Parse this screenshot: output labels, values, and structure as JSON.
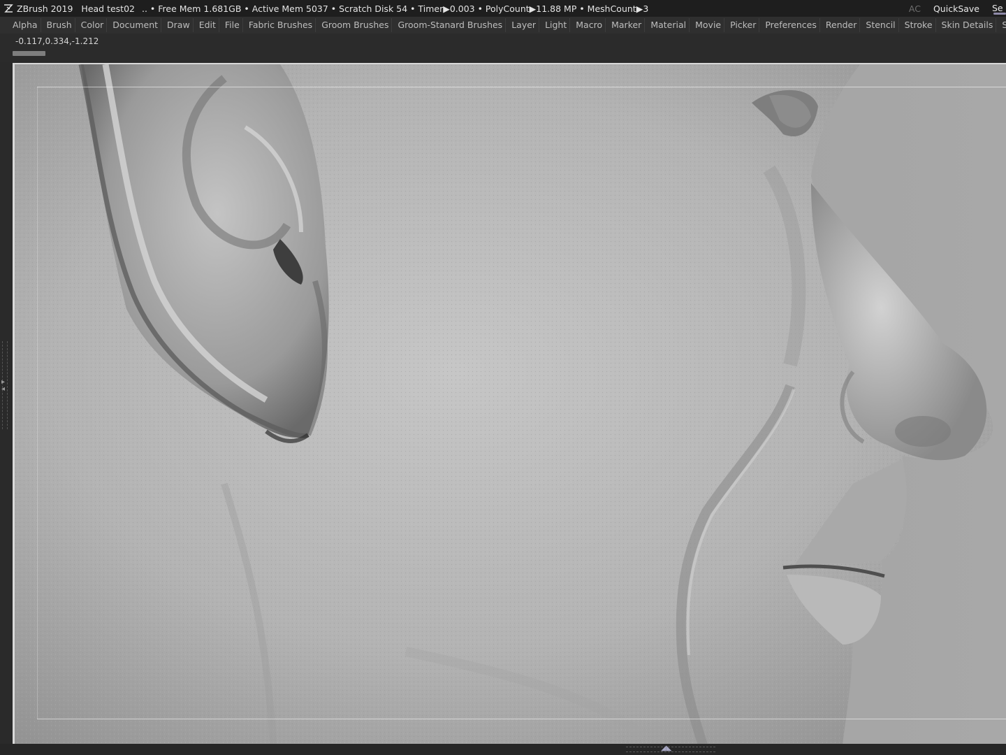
{
  "titlebar": {
    "app": "ZBrush 2019",
    "document": "Head test02",
    "stats": ".. • Free Mem 1.681GB • Active Mem 5037 • Scratch Disk 54 •  Timer▶0.003 • PolyCount▶11.88 MP  • MeshCount▶3",
    "ac": "AC",
    "quicksave": "QuickSave",
    "cut_label": "Se"
  },
  "menu": {
    "items": [
      {
        "label": "Alpha"
      },
      {
        "label": "Brush"
      },
      {
        "label": "Color"
      },
      {
        "label": "Document"
      },
      {
        "label": "Draw"
      },
      {
        "label": "Edit"
      },
      {
        "label": "File"
      },
      {
        "label": "Fabric Brushes"
      },
      {
        "label": "Groom Brushes"
      },
      {
        "label": "Groom-Stanard Brushes"
      },
      {
        "label": "Layer"
      },
      {
        "label": "Light"
      },
      {
        "label": "Macro"
      },
      {
        "label": "Marker"
      },
      {
        "label": "Material"
      },
      {
        "label": "Movie"
      },
      {
        "label": "Picker"
      },
      {
        "label": "Preferences"
      },
      {
        "label": "Render"
      },
      {
        "label": "Stencil"
      },
      {
        "label": "Stroke"
      },
      {
        "label": "Skin Details"
      },
      {
        "label": "Standard Bru"
      }
    ]
  },
  "info": {
    "coordinates": "-0.117,0.334,-1.212"
  },
  "colors": {
    "titlebar_bg": "#1e1e1e",
    "menubar_bg": "#2f2f2f",
    "canvas_bg": "#9a9a9a",
    "model_gray": "#b5b5b5",
    "accent": "#8f8aa8"
  },
  "icons": {
    "logo": "zbrush-logo-icon",
    "left_tray": "tray-expand-icon",
    "bottom_tray": "tray-expand-up-icon"
  }
}
